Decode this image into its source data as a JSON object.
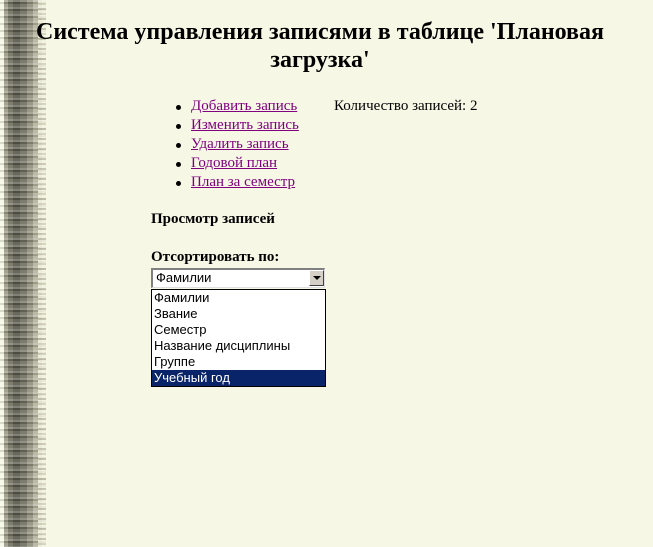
{
  "page": {
    "title": "Система управления записями в таблице 'Плановая загрузка'"
  },
  "menu": {
    "items": [
      {
        "label": "Добавить запись"
      },
      {
        "label": "Изменить запись"
      },
      {
        "label": "Удалить запись"
      },
      {
        "label": "Годовой план"
      },
      {
        "label": "План за семестр"
      }
    ]
  },
  "records": {
    "count_text": "Количество записей: 2"
  },
  "view": {
    "heading": "Просмотр записей",
    "sort_label": "Отсортировать по:"
  },
  "sort_select": {
    "value": "Фамилии",
    "options": [
      "Фамилии",
      "Звание",
      "Семестр",
      "Название дисциплины",
      "Группе",
      "Учебный год"
    ],
    "highlighted": "Учебный год"
  },
  "colors": {
    "background": "#f7f7e6",
    "link_visited": "#800080",
    "highlight": "#0a246a"
  }
}
